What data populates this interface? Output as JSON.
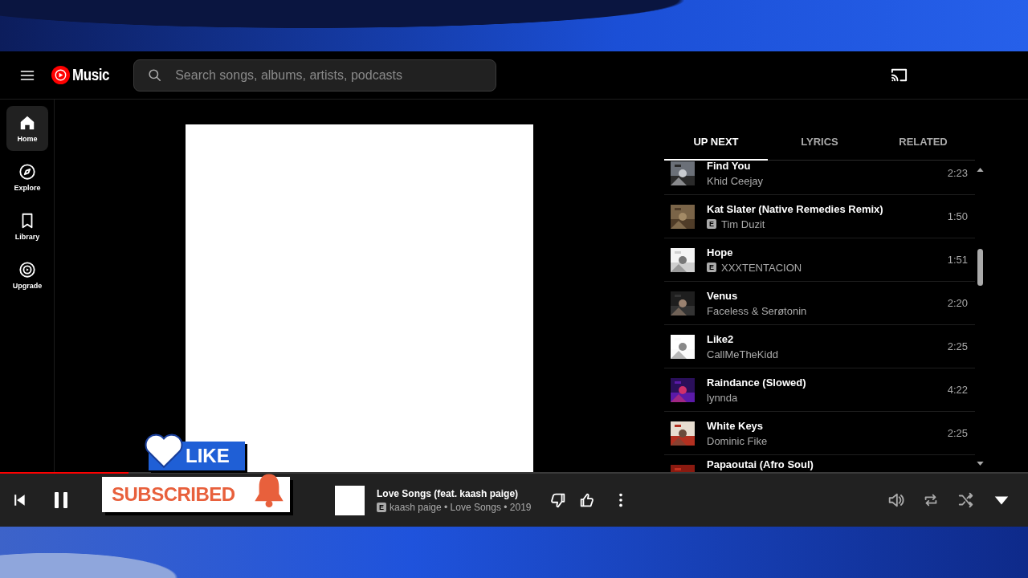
{
  "header": {
    "logo_text": "Music",
    "search": {
      "placeholder": "Search songs, albums, artists, podcasts"
    }
  },
  "sidebar": {
    "items": [
      {
        "label": "Home",
        "kind": "home",
        "selected": true
      },
      {
        "label": "Explore",
        "kind": "explore",
        "selected": false
      },
      {
        "label": "Library",
        "kind": "library",
        "selected": false
      },
      {
        "label": "Upgrade",
        "kind": "upgrade",
        "selected": false
      }
    ]
  },
  "queue": {
    "tabs": [
      {
        "label": "UP NEXT",
        "selected": true
      },
      {
        "label": "LYRICS",
        "selected": false
      },
      {
        "label": "RELATED",
        "selected": false
      }
    ],
    "items": [
      {
        "title": "Find You",
        "artist": "Khid Ceejay",
        "explicit": false,
        "duration": "2:23"
      },
      {
        "title": "Kat Slater (Native Remedies Remix)",
        "artist": "Tim Duzit",
        "explicit": true,
        "explicit_mark": "E",
        "duration": "1:50"
      },
      {
        "title": "Hope",
        "artist": "XXXTENTACION",
        "explicit": true,
        "explicit_mark": "E",
        "duration": "1:51"
      },
      {
        "title": "Venus",
        "artist": "Faceless & Serøtonin",
        "explicit": false,
        "duration": "2:20"
      },
      {
        "title": "Like2",
        "artist": "CallMeTheKidd",
        "explicit": false,
        "duration": "2:25"
      },
      {
        "title": "Raindance (Slowed)",
        "artist": "lynnda",
        "explicit": false,
        "duration": "4:22"
      },
      {
        "title": "White Keys",
        "artist": "Dominic Fike",
        "explicit": false,
        "duration": "2:25"
      },
      {
        "title": "Papaoutai (Afro Soul)"
      }
    ]
  },
  "player": {
    "progress": {
      "level": 0.125
    },
    "playing": true,
    "track": {
      "title": "Love Songs (feat. kaash paige)",
      "explicit": true,
      "explicit_mark": "E",
      "subtitle": "kaash paige • Love Songs • 2019"
    }
  },
  "overlays": {
    "like_label": "LIKE",
    "subscribe_label": "SUBSCRIBED"
  }
}
